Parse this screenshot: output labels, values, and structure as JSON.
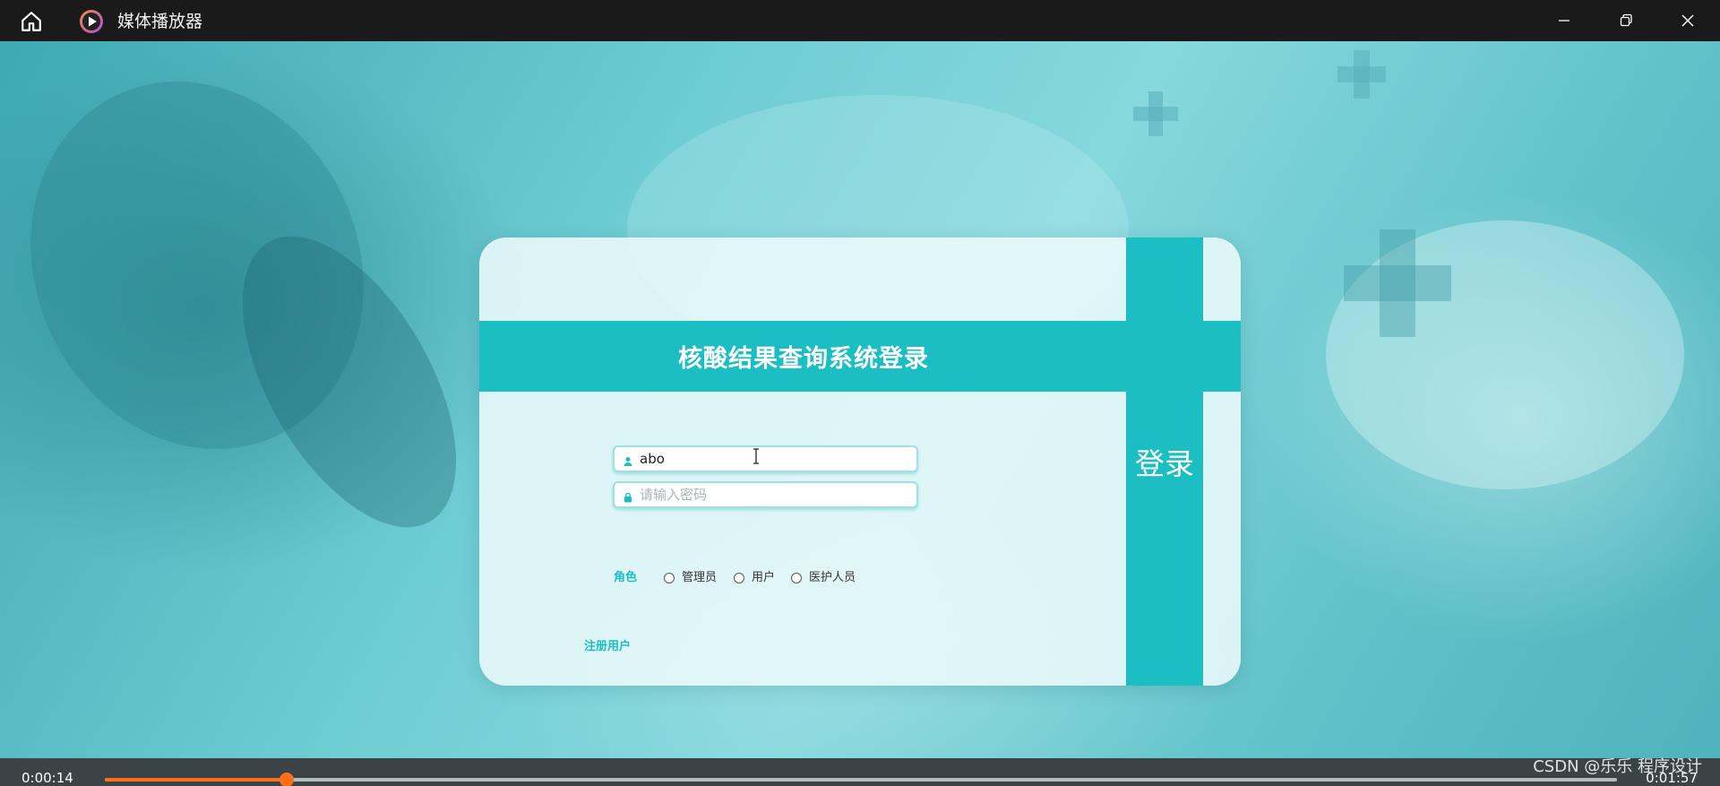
{
  "window": {
    "title": "媒体播放器"
  },
  "login": {
    "heading": "核酸结果查询系统登录",
    "username_value": "abo",
    "password_placeholder": "请输入密码",
    "role_label": "角色",
    "roles": [
      "管理员",
      "用户",
      "医护人员"
    ],
    "login_button": "登录",
    "register_link": "注册用户"
  },
  "player": {
    "current_time": "0:00:14",
    "total_time": "0:01:57",
    "progress_fraction": 0.12
  },
  "watermark": "CSDN @乐乐 程序设计",
  "colors": {
    "accent": "#1bbec3",
    "progress": "#ff6f1a"
  }
}
